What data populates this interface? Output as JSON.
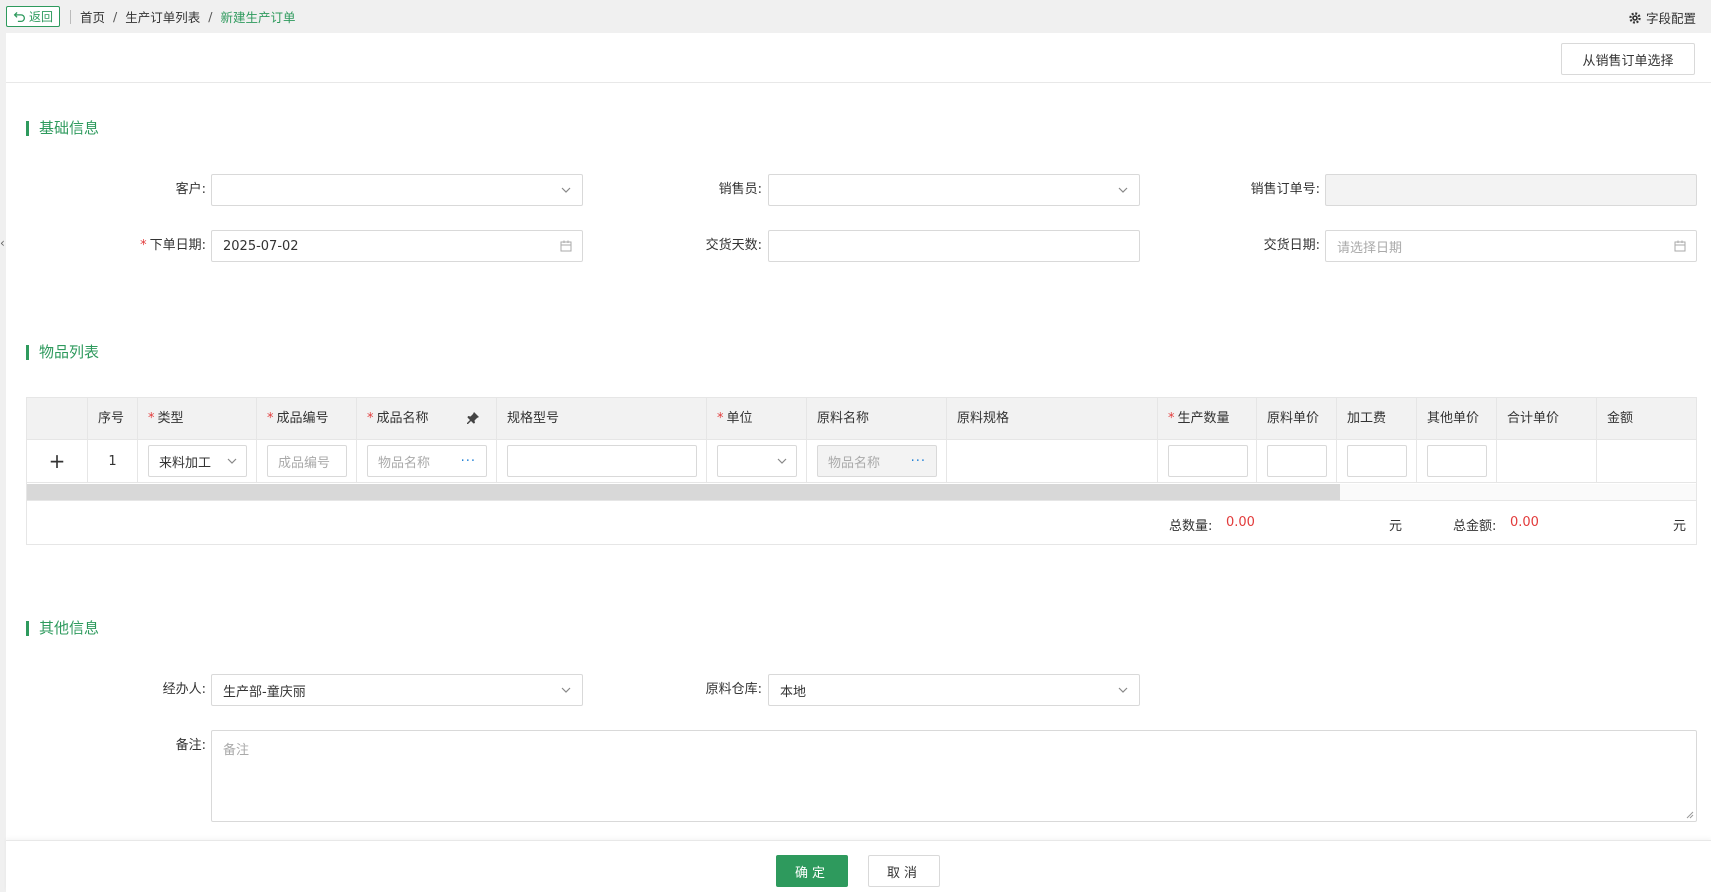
{
  "topbar": {
    "back_label": "返回",
    "breadcrumb": [
      "首页",
      "生产订单列表",
      "新建生产订单"
    ],
    "crumb_separator": "/",
    "field_config_label": "字段配置"
  },
  "toolbar": {
    "from_sales_label": "从销售订单选择"
  },
  "basic": {
    "title": "基础信息",
    "customer_label": "客户:",
    "customer_value": "",
    "salesman_label": "销售员:",
    "salesman_value": "",
    "sales_order_label": "销售订单号:",
    "sales_order_value": "",
    "order_date_label": "下单日期:",
    "order_date_value": "2025-07-02",
    "delivery_days_label": "交货天数:",
    "delivery_days_value": "",
    "delivery_date_label": "交货日期:",
    "delivery_date_placeholder": "请选择日期"
  },
  "items": {
    "title": "物品列表",
    "columns": [
      {
        "label": "序号",
        "required": false
      },
      {
        "label": "类型",
        "required": true
      },
      {
        "label": "成品编号",
        "required": true
      },
      {
        "label": "成品名称",
        "required": true
      },
      {
        "label": "规格型号",
        "required": false
      },
      {
        "label": "单位",
        "required": true
      },
      {
        "label": "原料名称",
        "required": false
      },
      {
        "label": "原料规格",
        "required": false
      },
      {
        "label": "生产数量",
        "required": true
      },
      {
        "label": "原料单价",
        "required": false
      },
      {
        "label": "加工费",
        "required": false
      },
      {
        "label": "其他单价",
        "required": false
      },
      {
        "label": "合计单价",
        "required": false
      },
      {
        "label": "金额",
        "required": false
      }
    ],
    "required_mark": "*",
    "add_symbol": "+",
    "row": {
      "index": "1",
      "type_value": "来料加工",
      "product_code_placeholder": "成品编号",
      "product_name_placeholder": "物品名称",
      "material_name_placeholder": "物品名称",
      "dots": "···"
    },
    "summary": {
      "total_qty_label": "总数量:",
      "total_qty_value": "0.00",
      "unit1": "元",
      "total_amount_label": "总金额:",
      "total_amount_value": "0.00",
      "unit2": "元"
    }
  },
  "other": {
    "title": "其他信息",
    "handler_label": "经办人:",
    "handler_value": "生产部-童庆丽",
    "warehouse_label": "原料仓库:",
    "warehouse_value": "本地",
    "remark_label": "备注:",
    "remark_placeholder": "备注"
  },
  "footer": {
    "confirm_label": "确定",
    "cancel_label": "取消"
  },
  "colors": {
    "accent": "#2e9a5d",
    "required": "#e23b3b",
    "link": "#1e7fd6"
  },
  "icons": [
    "return-icon",
    "gear-icon",
    "chevron-down-icon",
    "calendar-icon",
    "pin-icon",
    "plus-icon",
    "collapse-left-icon"
  ]
}
